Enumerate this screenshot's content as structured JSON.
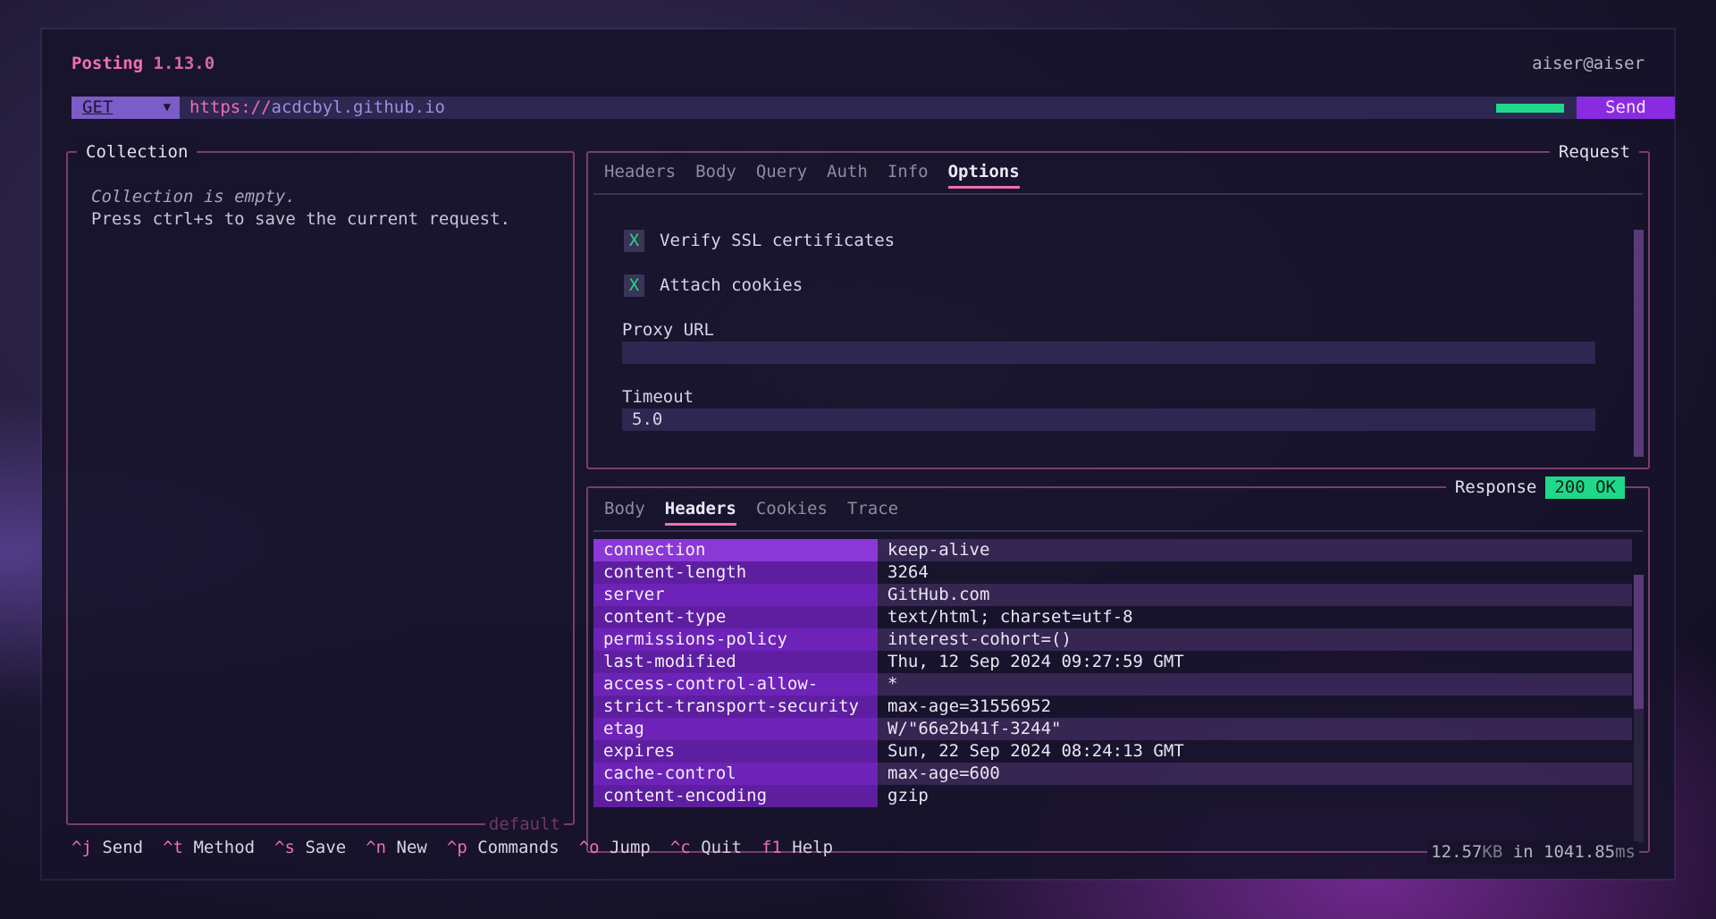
{
  "header": {
    "app_name": "Posting",
    "version": "1.13.0",
    "user": "aiser@aiser"
  },
  "urlbar": {
    "method": "GET",
    "url_scheme": "https://",
    "url_host": "acdcbyl.github.io",
    "send_label": "Send"
  },
  "collection": {
    "title": "Collection",
    "empty_text": "Collection is empty.",
    "hint_text": "Press ctrl+s to save the current request.",
    "footer": "default"
  },
  "request": {
    "title": "Request",
    "tabs": [
      "Headers",
      "Body",
      "Query",
      "Auth",
      "Info",
      "Options"
    ],
    "active_tab": "Options",
    "options": {
      "verify_ssl_mark": "X",
      "verify_ssl_label": "Verify SSL certificates",
      "attach_cookies_mark": "X",
      "attach_cookies_label": "Attach cookies",
      "proxy_label": "Proxy URL",
      "proxy_value": "",
      "timeout_label": "Timeout",
      "timeout_value": "5.0"
    }
  },
  "response": {
    "title": "Response",
    "status": "200 OK",
    "tabs": [
      "Body",
      "Headers",
      "Cookies",
      "Trace"
    ],
    "active_tab": "Headers",
    "headers": [
      {
        "key": "connection",
        "value": "keep-alive"
      },
      {
        "key": "content-length",
        "value": "3264"
      },
      {
        "key": "server",
        "value": "GitHub.com"
      },
      {
        "key": "content-type",
        "value": "text/html; charset=utf-8"
      },
      {
        "key": "permissions-policy",
        "value": "interest-cohort=()"
      },
      {
        "key": "last-modified",
        "value": "Thu, 12 Sep 2024 09:27:59 GMT"
      },
      {
        "key": "access-control-allow-origin",
        "value": "*"
      },
      {
        "key": "strict-transport-security",
        "value": "max-age=31556952"
      },
      {
        "key": "etag",
        "value": "W/\"66e2b41f-3244\""
      },
      {
        "key": "expires",
        "value": "Sun, 22 Sep 2024 08:24:13 GMT"
      },
      {
        "key": "cache-control",
        "value": "max-age=600"
      },
      {
        "key": "content-encoding",
        "value": "gzip"
      }
    ],
    "size_value": "12.57",
    "size_unit": "KB",
    "in_text": " in ",
    "time_value": "1041.85",
    "time_unit": "ms"
  },
  "footer_keys": [
    {
      "key": "^j",
      "label": "Send"
    },
    {
      "key": "^t",
      "label": "Method"
    },
    {
      "key": "^s",
      "label": "Save"
    },
    {
      "key": "^n",
      "label": "New"
    },
    {
      "key": "^p",
      "label": "Commands"
    },
    {
      "key": "^o",
      "label": "Jump"
    },
    {
      "key": "^c",
      "label": "Quit"
    },
    {
      "key": "f1",
      "label": "Help"
    }
  ],
  "colors": {
    "accent_pink": "#f06fb3",
    "accent_purple": "#8a2be2",
    "status_green": "#1fd88a"
  }
}
